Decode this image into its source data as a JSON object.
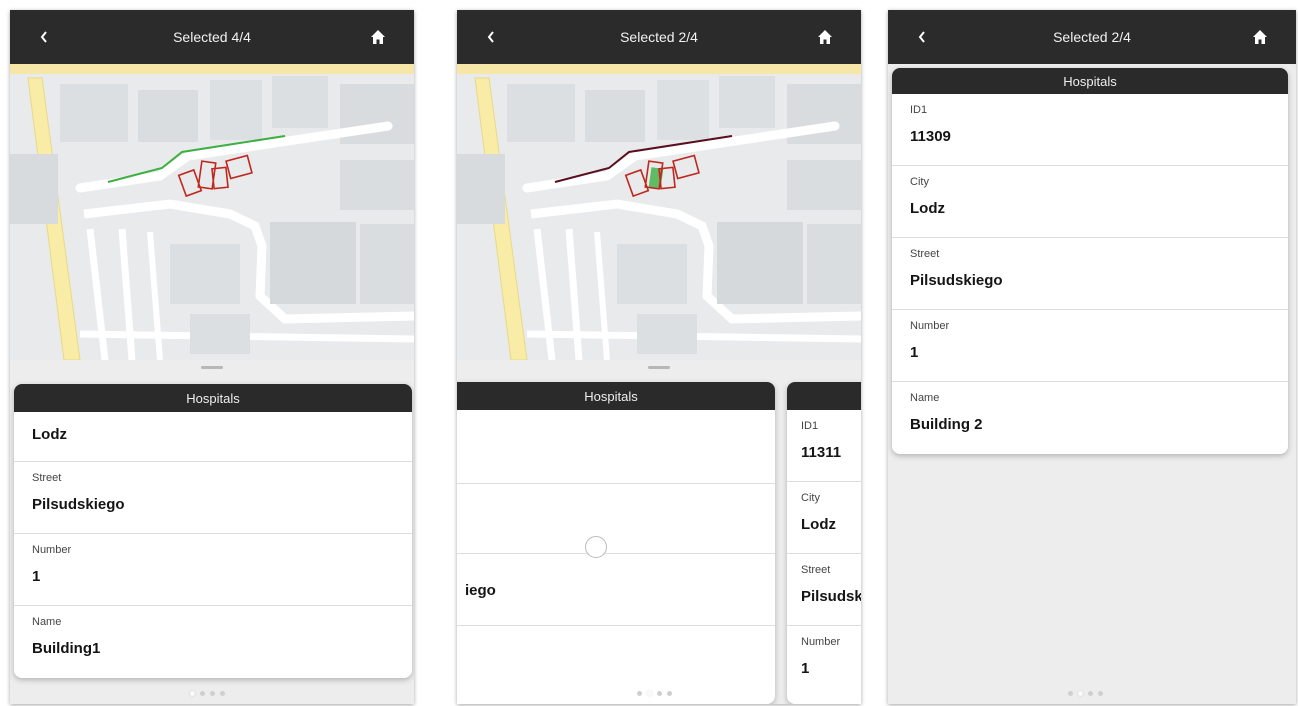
{
  "screens": [
    {
      "title": "Selected 4/4",
      "card_title": "Hospitals",
      "fields": [
        {
          "label": "",
          "value": "Lodz"
        },
        {
          "label": "Street",
          "value": "Pilsudskiego"
        },
        {
          "label": "Number",
          "value": "1"
        },
        {
          "label": "Name",
          "value": "Building1"
        }
      ]
    },
    {
      "title": "Selected 2/4",
      "card_title": "Hospitals",
      "partial_value": "iego",
      "next_card_fields": [
        {
          "label": "ID1",
          "value": "11311"
        },
        {
          "label": "City",
          "value": "Lodz"
        },
        {
          "label": "Street",
          "value": "Pilsudsk"
        },
        {
          "label": "Number",
          "value": "1"
        }
      ]
    },
    {
      "title": "Selected 2/4",
      "card_title": "Hospitals",
      "fields": [
        {
          "label": "ID1",
          "value": "11309"
        },
        {
          "label": "City",
          "value": "Lodz"
        },
        {
          "label": "Street",
          "value": "Pilsudskiego"
        },
        {
          "label": "Number",
          "value": "1"
        },
        {
          "label": "Name",
          "value": "Building 2"
        }
      ]
    }
  ],
  "icons": {
    "back": "chevron-left-icon",
    "home": "home-icon"
  },
  "colors": {
    "topbar": "#2b2b2b",
    "selected_line_1": "#3cb043",
    "selected_line_2": "#5a0f1f",
    "building_outline": "#c0281e",
    "selected_building": "#3cb043"
  }
}
